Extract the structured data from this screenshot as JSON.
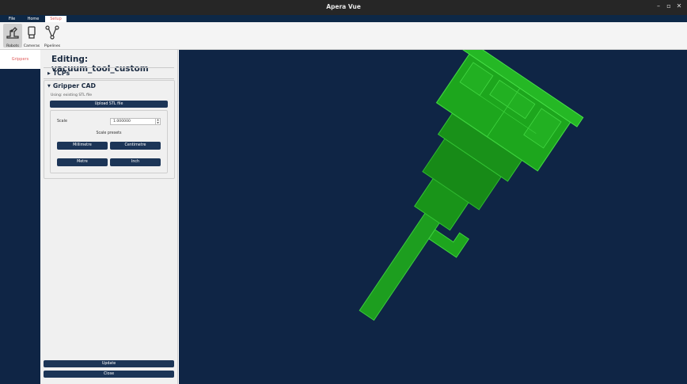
{
  "window": {
    "title": "Apera Vue",
    "controls": [
      "–",
      "▫",
      "✕"
    ]
  },
  "menu_tabs": [
    {
      "label": "File",
      "active": false
    },
    {
      "label": "Home",
      "active": false
    },
    {
      "label": "Setup",
      "active": true
    }
  ],
  "ribbon": {
    "items": [
      {
        "label": "Robots",
        "icon": "robot-icon",
        "active": true
      },
      {
        "label": "Cameras",
        "icon": "camera-icon",
        "active": false
      },
      {
        "label": "Pipelines",
        "icon": "pipeline-icon",
        "active": false
      }
    ]
  },
  "leftnav": {
    "items": [
      {
        "label": "Grippers",
        "active": true
      }
    ]
  },
  "panel": {
    "heading": "Editing: vacuum_tool_custom",
    "tcps": {
      "label": "TCPs",
      "expanded": false
    },
    "gripper_cad": {
      "label": "Gripper CAD",
      "expanded": true,
      "status_text": "Using: existing STL file",
      "upload_label": "Upload STL file",
      "scale_label": "Scale",
      "scale_value": "1.000000",
      "presets_label": "Scale presets",
      "presets": [
        "Millimetre",
        "Centimetre",
        "Metre",
        "Inch"
      ]
    },
    "update_label": "Update",
    "close_label": "Close"
  },
  "viewport": {
    "model_color": "#1fae1f",
    "background": "#0f2545"
  }
}
